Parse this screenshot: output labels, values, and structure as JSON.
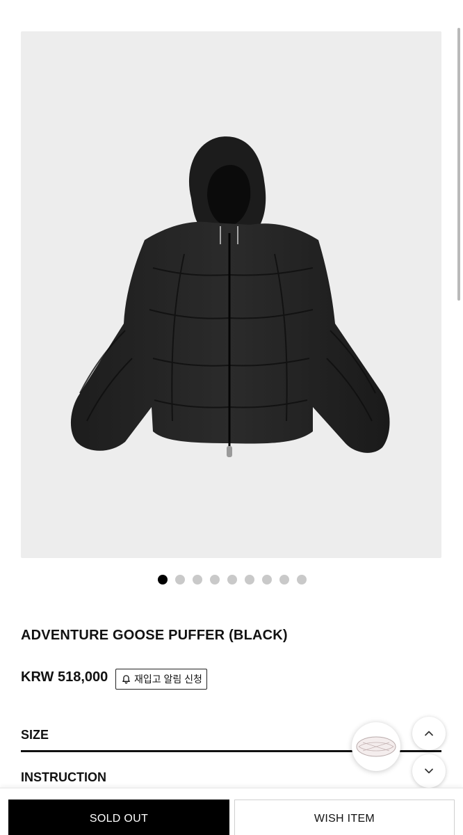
{
  "product": {
    "title": "ADVENTURE GOOSE PUFFER (BLACK)",
    "price": "KRW 518,000",
    "restock_label": "재입고 알림 신청",
    "image_subject": "black hooded goose down puffer jacket"
  },
  "gallery": {
    "slide_count": 9,
    "active_index": 0,
    "background": "#ededed"
  },
  "accordion": {
    "size_label": "SIZE",
    "instruction_label": "INSTRUCTION"
  },
  "actions": {
    "sold_out_label": "SOLD OUT",
    "wish_label": "WISH ITEM"
  },
  "icons": {
    "restock": "bell-icon",
    "scroll_up": "chevron-up-icon",
    "scroll_down": "chevron-down-icon",
    "thumb": "product-thumbnail"
  },
  "colors": {
    "primary": "#000000",
    "dot_inactive": "#c9c9c9",
    "gallery_bg": "#ededed"
  }
}
